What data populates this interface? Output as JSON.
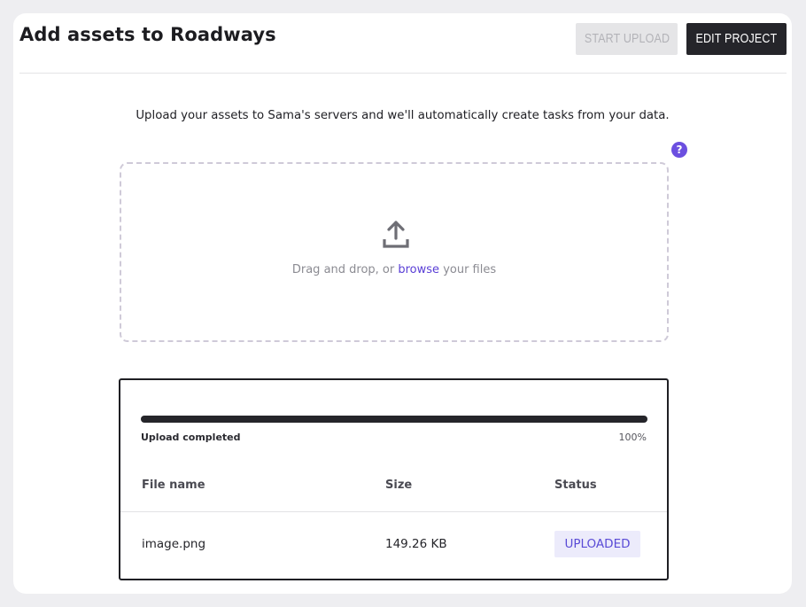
{
  "header": {
    "title": "Add assets to Roadways",
    "start_upload_label": "START UPLOAD",
    "edit_project_label": "EDIT PROJECT"
  },
  "intro_text": "Upload your assets to Sama's servers and we'll automatically create tasks from your data.",
  "help_icon": {
    "glyph": "?",
    "name": "help-icon",
    "color": "#6b4fe0"
  },
  "dropzone": {
    "icon": "upload-icon",
    "text_before": "Drag and drop, or",
    "browse_label": "browse",
    "text_after": "your files"
  },
  "upload": {
    "status_label": "Upload completed",
    "progress_text": "100%",
    "progress_fraction": 1.0,
    "columns": [
      "File name",
      "Size",
      "Status"
    ],
    "files": [
      {
        "name": "image.png",
        "size": "149.26 KB",
        "status": "UPLOADED"
      }
    ]
  },
  "colors": {
    "accent": "#5a3fd6",
    "dark": "#25252a",
    "disabled_bg": "#e5e5e7",
    "badge_bg": "#ecebfb"
  }
}
